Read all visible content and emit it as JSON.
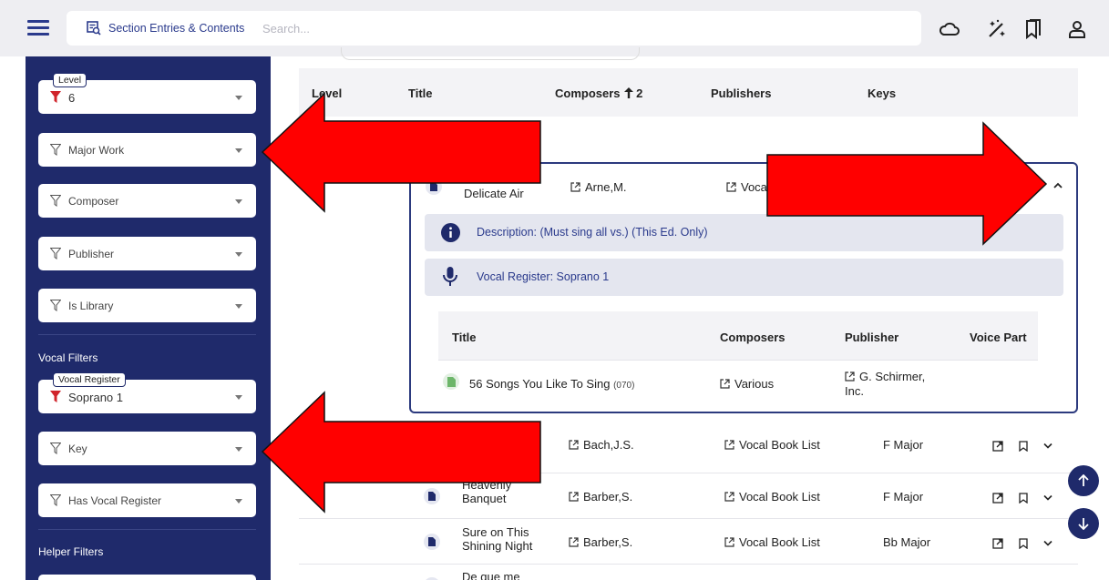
{
  "header": {
    "section_label": "Section Entries & Contents",
    "search_placeholder": "Search..."
  },
  "sidebar": {
    "level": {
      "label": "Level",
      "value": "6"
    },
    "major_work": "Major Work",
    "composer": "Composer",
    "publisher": "Publisher",
    "is_library": "Is Library",
    "vocal_filters_title": "Vocal Filters",
    "vocal_register": {
      "label": "Vocal Register",
      "value": "Soprano 1"
    },
    "key": "Key",
    "has_vocal_register": "Has Vocal Register",
    "helper_filters_title": "Helper Filters"
  },
  "table": {
    "headers": {
      "level": "Level",
      "title": "Title",
      "composers": "Composers",
      "composers_sort_count": "2",
      "publishers": "Publishers",
      "keys": "Keys"
    },
    "expanded": {
      "title": "Delicate Air",
      "composer": "Arne,M.",
      "publisher": "Vocal Book List",
      "description": "Description: (Must sing all vs.) (This Ed. Only)",
      "vocal_register": "Vocal Register: Soprano 1",
      "inner_headers": {
        "title": "Title",
        "composers": "Composers",
        "publisher": "Publisher",
        "voice_part": "Voice Part"
      },
      "inner_row": {
        "title": "56 Songs You Like To Sing",
        "code": "(070)",
        "composer": "Various",
        "publisher_line1": "G. Schirmer,",
        "publisher_line2": "Inc."
      }
    },
    "rows": [
      {
        "title_line1": "",
        "title_line2": "",
        "composer": "Bach,J.S.",
        "publisher": "Vocal Book List",
        "key": "F Major"
      },
      {
        "title_line1": "Heavenly",
        "title_line2": "Banquet",
        "composer": "Barber,S.",
        "publisher": "Vocal Book List",
        "key": "F Major"
      },
      {
        "title_line1": "Sure on This",
        "title_line2": "Shining Night",
        "composer": "Barber,S.",
        "publisher": "Vocal Book List",
        "key": "Bb Major"
      },
      {
        "title_line1": "De que me",
        "title_line2": "",
        "composer": "",
        "publisher": "",
        "key": ""
      }
    ]
  },
  "colors": {
    "accent": "#1f2a6b",
    "annotation_arrow": "#ff0000"
  }
}
